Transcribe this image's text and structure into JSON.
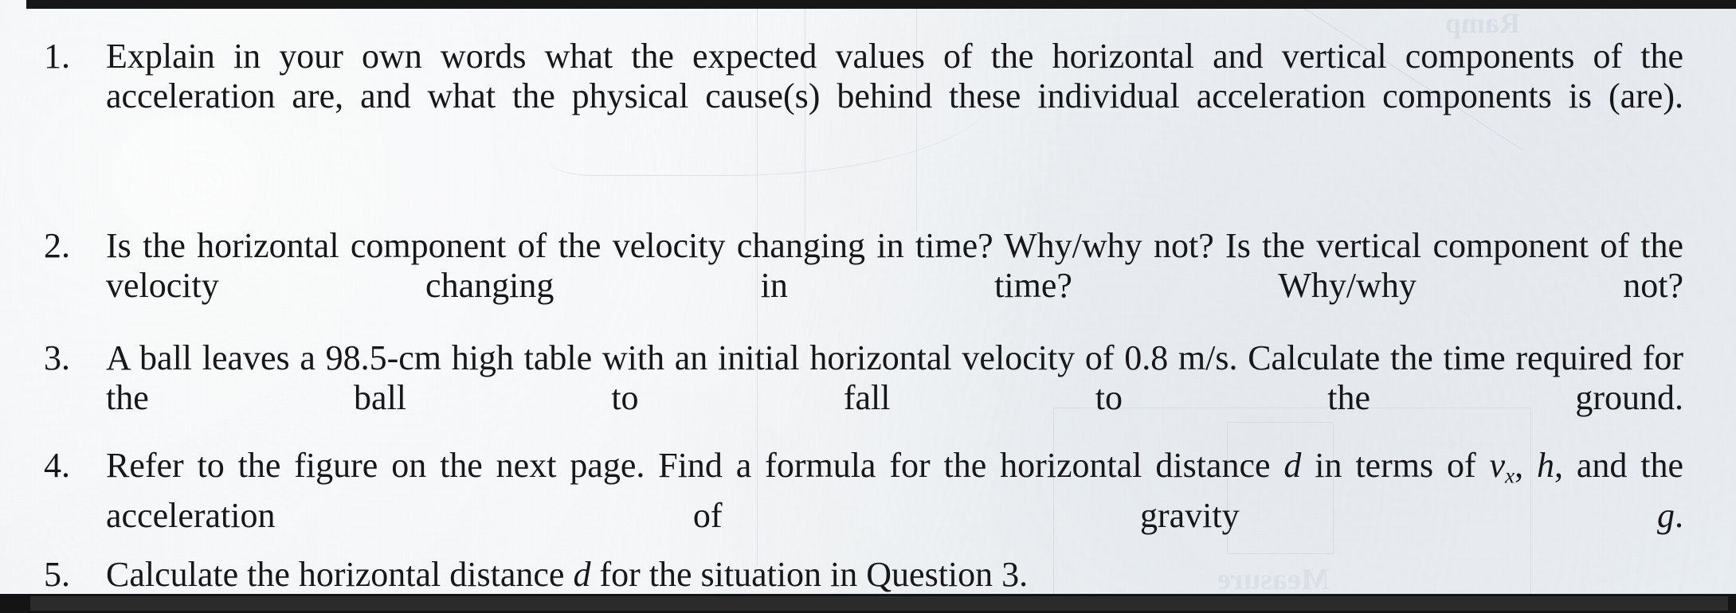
{
  "document": {
    "type": "scanned-worksheet",
    "subject_hint": "projectile motion problem set",
    "background_color": "#f1f3f5",
    "ink_color": "#1b1b1e",
    "scan_bar_color": "#161616"
  },
  "questions": [
    {
      "number": "1.",
      "text": "Explain in your own words what the expected values of the horizontal and vertical components of the acceleration are, and what the physical cause(s) behind these individual acceleration components is (are).",
      "justified": true
    },
    {
      "number": "2.",
      "text": "Is the horizontal component of the velocity changing in time? Why/why not? Is the vertical component of the velocity changing in time? Why/why not?",
      "justified": true
    },
    {
      "number": "3.",
      "text": "A ball leaves a 98.5-cm high table with an initial horizontal velocity of 0.8 m/s. Calculate the time required for the ball to fall to the ground.",
      "justified": true
    },
    {
      "number": "4.",
      "parts": {
        "lead": "Refer to the figure on the next page. Find a formula for the horizontal distance ",
        "var_d": "d",
        "mid": " in terms of ",
        "var_v": "v",
        "var_v_sub": "x",
        "after_v": ", ",
        "var_h": "h",
        "tail": ", and the acceleration of gravity ",
        "var_g": "g",
        "end": "."
      },
      "justified": true
    },
    {
      "number": "5.",
      "parts": {
        "lead": "Calculate the horizontal distance ",
        "var_d": "d",
        "tail": " for the situation in Question 3."
      },
      "justified": false
    }
  ],
  "artifacts": {
    "showthrough_ramp": "Ramp",
    "showthrough_measure": "Measure"
  }
}
